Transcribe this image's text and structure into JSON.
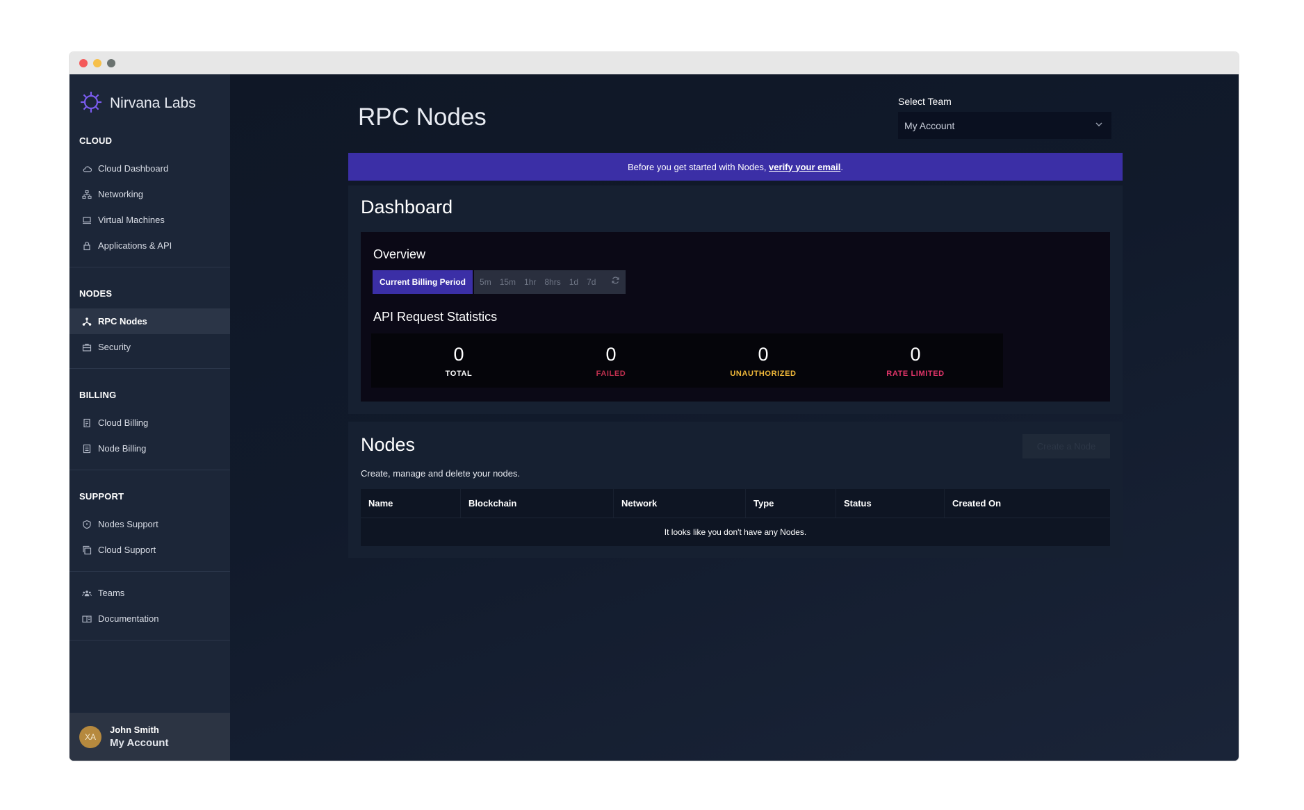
{
  "brand": {
    "name": "Nirvana Labs"
  },
  "sidebar": {
    "sections": [
      {
        "title": "CLOUD",
        "items": [
          {
            "label": "Cloud Dashboard",
            "icon": "cloud-icon"
          },
          {
            "label": "Networking",
            "icon": "network-icon"
          },
          {
            "label": "Virtual Machines",
            "icon": "laptop-icon"
          },
          {
            "label": "Applications & API",
            "icon": "lock-icon"
          }
        ]
      },
      {
        "title": "NODES",
        "items": [
          {
            "label": "RPC Nodes",
            "icon": "nodes-icon",
            "active": true
          },
          {
            "label": "Security",
            "icon": "briefcase-icon"
          }
        ]
      },
      {
        "title": "BILLING",
        "items": [
          {
            "label": "Cloud Billing",
            "icon": "receipt-icon"
          },
          {
            "label": "Node Billing",
            "icon": "document-icon"
          }
        ]
      },
      {
        "title": "SUPPORT",
        "items": [
          {
            "label": "Nodes Support",
            "icon": "shield-icon"
          },
          {
            "label": "Cloud Support",
            "icon": "copy-icon"
          }
        ]
      },
      {
        "title": "",
        "items": [
          {
            "label": "Teams",
            "icon": "team-icon"
          },
          {
            "label": "Documentation",
            "icon": "book-icon"
          }
        ]
      }
    ]
  },
  "user": {
    "initials": "XA",
    "name": "John Smith",
    "account": "My Account"
  },
  "header": {
    "title": "RPC Nodes",
    "team_label": "Select Team",
    "team_value": "My Account"
  },
  "banner": {
    "prefix": "Before you get started with Nodes, ",
    "link": "verify your email",
    "suffix": "."
  },
  "dashboard": {
    "title": "Dashboard",
    "overview_title": "Overview",
    "active_period": "Current Billing Period",
    "periods": [
      "5m",
      "15m",
      "1hr",
      "8hrs",
      "1d",
      "7d"
    ],
    "stats_title": "API Request Statistics",
    "stats": [
      {
        "value": "0",
        "label": "TOTAL",
        "color": "#ffffff"
      },
      {
        "value": "0",
        "label": "FAILED",
        "color": "#c0304f"
      },
      {
        "value": "0",
        "label": "UNAUTHORIZED",
        "color": "#f1b93a"
      },
      {
        "value": "0",
        "label": "RATE LIMITED",
        "color": "#e2356a"
      }
    ]
  },
  "nodes": {
    "title": "Nodes",
    "subtitle": "Create, manage and delete your nodes.",
    "create_label": "Create a Node",
    "columns": [
      "Name",
      "Blockchain",
      "Network",
      "Type",
      "Status",
      "Created On"
    ],
    "empty_message": "It looks like you don't have any Nodes."
  },
  "colors": {
    "accent": "#3b2fa6",
    "sidebar": "#1c2638",
    "background": "#111a2b"
  }
}
